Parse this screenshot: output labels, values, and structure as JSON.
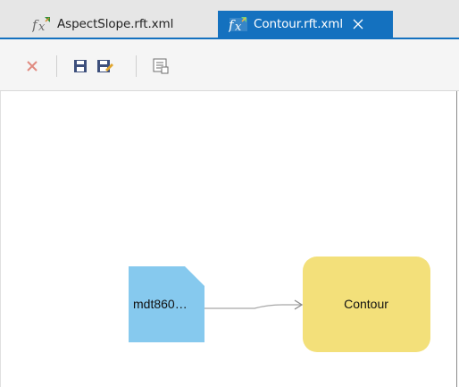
{
  "tabs": [
    {
      "label": "AspectSlope.rft.xml",
      "icon": "function-raster-icon",
      "active": false
    },
    {
      "label": "Contour.rft.xml",
      "icon": "function-raster-icon",
      "active": true,
      "close_icon": "close-icon"
    }
  ],
  "toolbar": {
    "buttons": [
      {
        "name": "delete",
        "icon": "delete-x-icon"
      },
      {
        "name": "save",
        "icon": "save-icon"
      },
      {
        "name": "save-as",
        "icon": "save-as-icon"
      },
      {
        "name": "properties",
        "icon": "properties-icon"
      }
    ]
  },
  "diagram": {
    "input_node": {
      "label": "mdt860…",
      "color": "#86c9ee"
    },
    "function_node": {
      "label": "Contour",
      "color": "#f3e07a"
    }
  },
  "colors": {
    "accent": "#1471bf",
    "delete_icon": "#e08b80",
    "save_icon": "#3d4f7c"
  }
}
